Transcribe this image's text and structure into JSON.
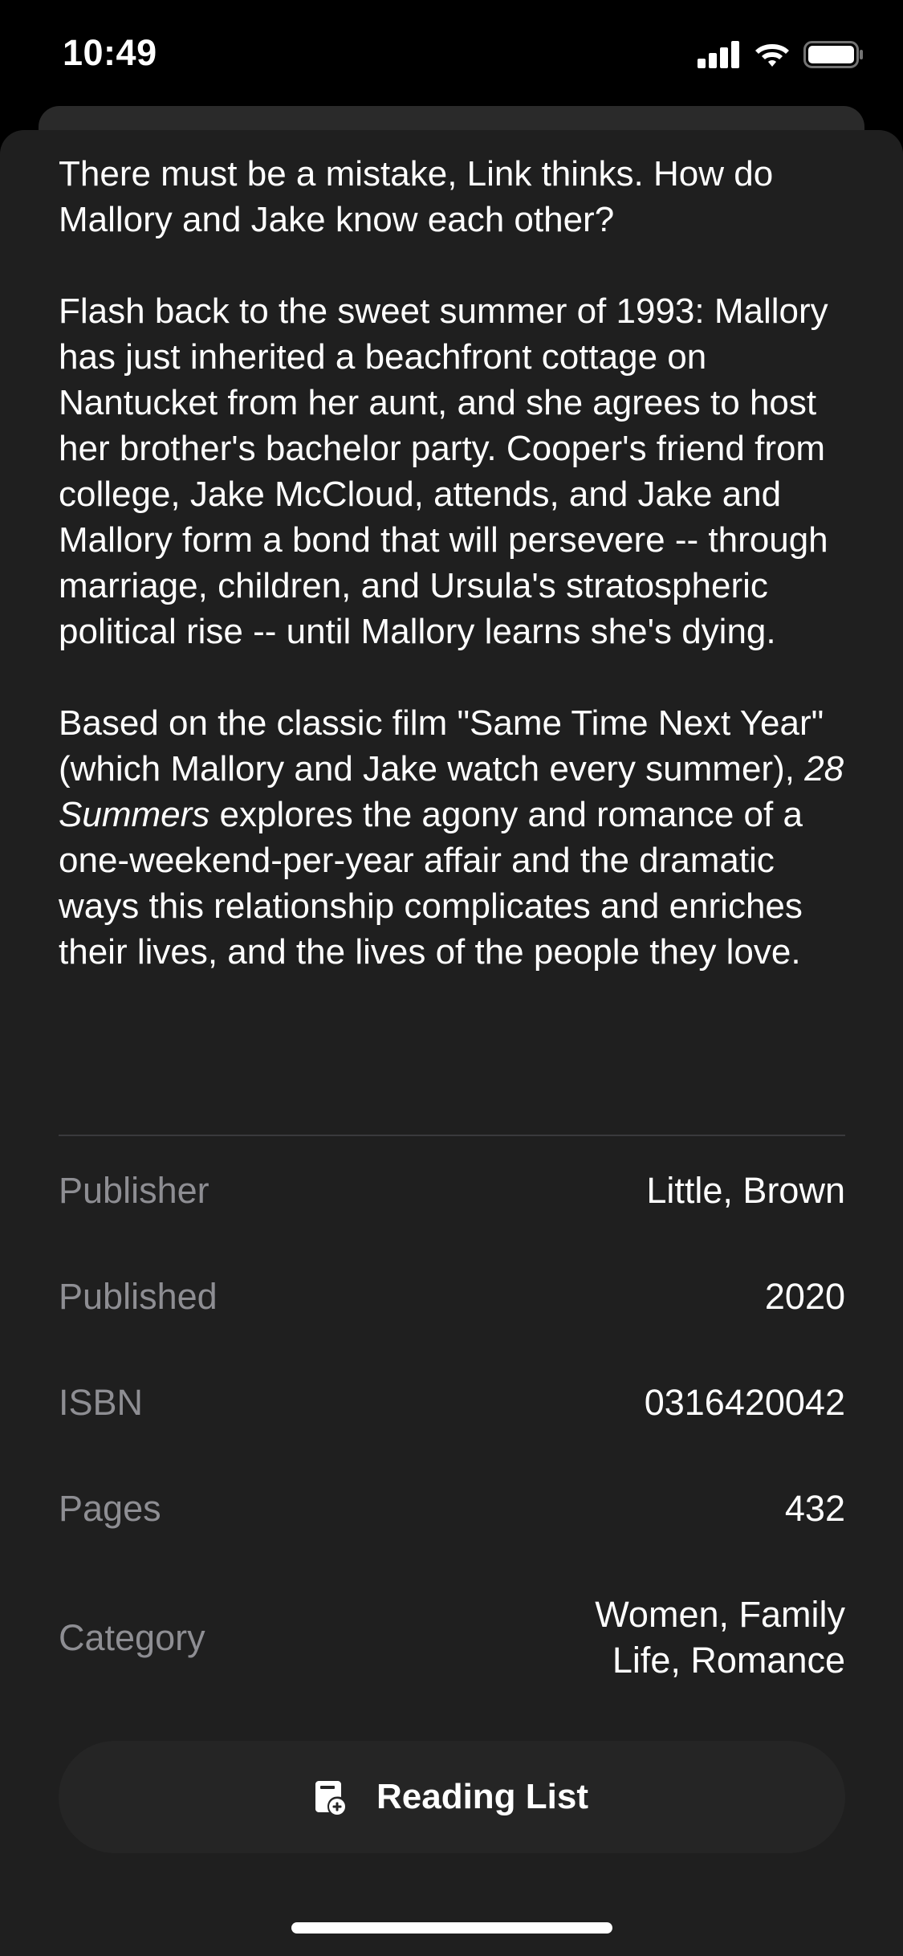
{
  "status_bar": {
    "time": "10:49",
    "icons": [
      "signal-icon",
      "wifi-icon",
      "battery-icon"
    ]
  },
  "description": {
    "p1": "There must be a mistake, Link thinks. How do Mallory and Jake know each other?",
    "p2": "Flash back to the sweet summer of 1993: Mallory has just inherited a beachfront cottage on Nantucket from her aunt, and she agrees to host her brother's bachelor party. Cooper's friend from college, Jake McCloud, attends, and Jake and Mallory form a bond that will persevere -- through marriage, children, and Ursula's stratospheric political rise -- until Mallory learns she's dying.",
    "p3_before": "Based on the classic film \"Same Time Next Year\" (which Mallory and Jake watch every summer), ",
    "p3_title": "28 Summers",
    "p3_after": " explores the agony and romance of a one-weekend-per-year affair and the dramatic ways this relationship complicates and enriches their lives, and the lives of the people they love."
  },
  "details": {
    "publisher": {
      "label": "Publisher",
      "value": "Little, Brown"
    },
    "published": {
      "label": "Published",
      "value": "2020"
    },
    "isbn": {
      "label": "ISBN",
      "value": "0316420042"
    },
    "pages": {
      "label": "Pages",
      "value": "432"
    },
    "category": {
      "label": "Category",
      "value": "Women, Family Life, Romance"
    }
  },
  "reading_list_button": {
    "label": "Reading List",
    "icon": "book-add-icon"
  },
  "colors": {
    "background": "#000000",
    "sheet": "#1f1f1f",
    "secondary_text": "#8e8e93",
    "button": "#252525"
  }
}
